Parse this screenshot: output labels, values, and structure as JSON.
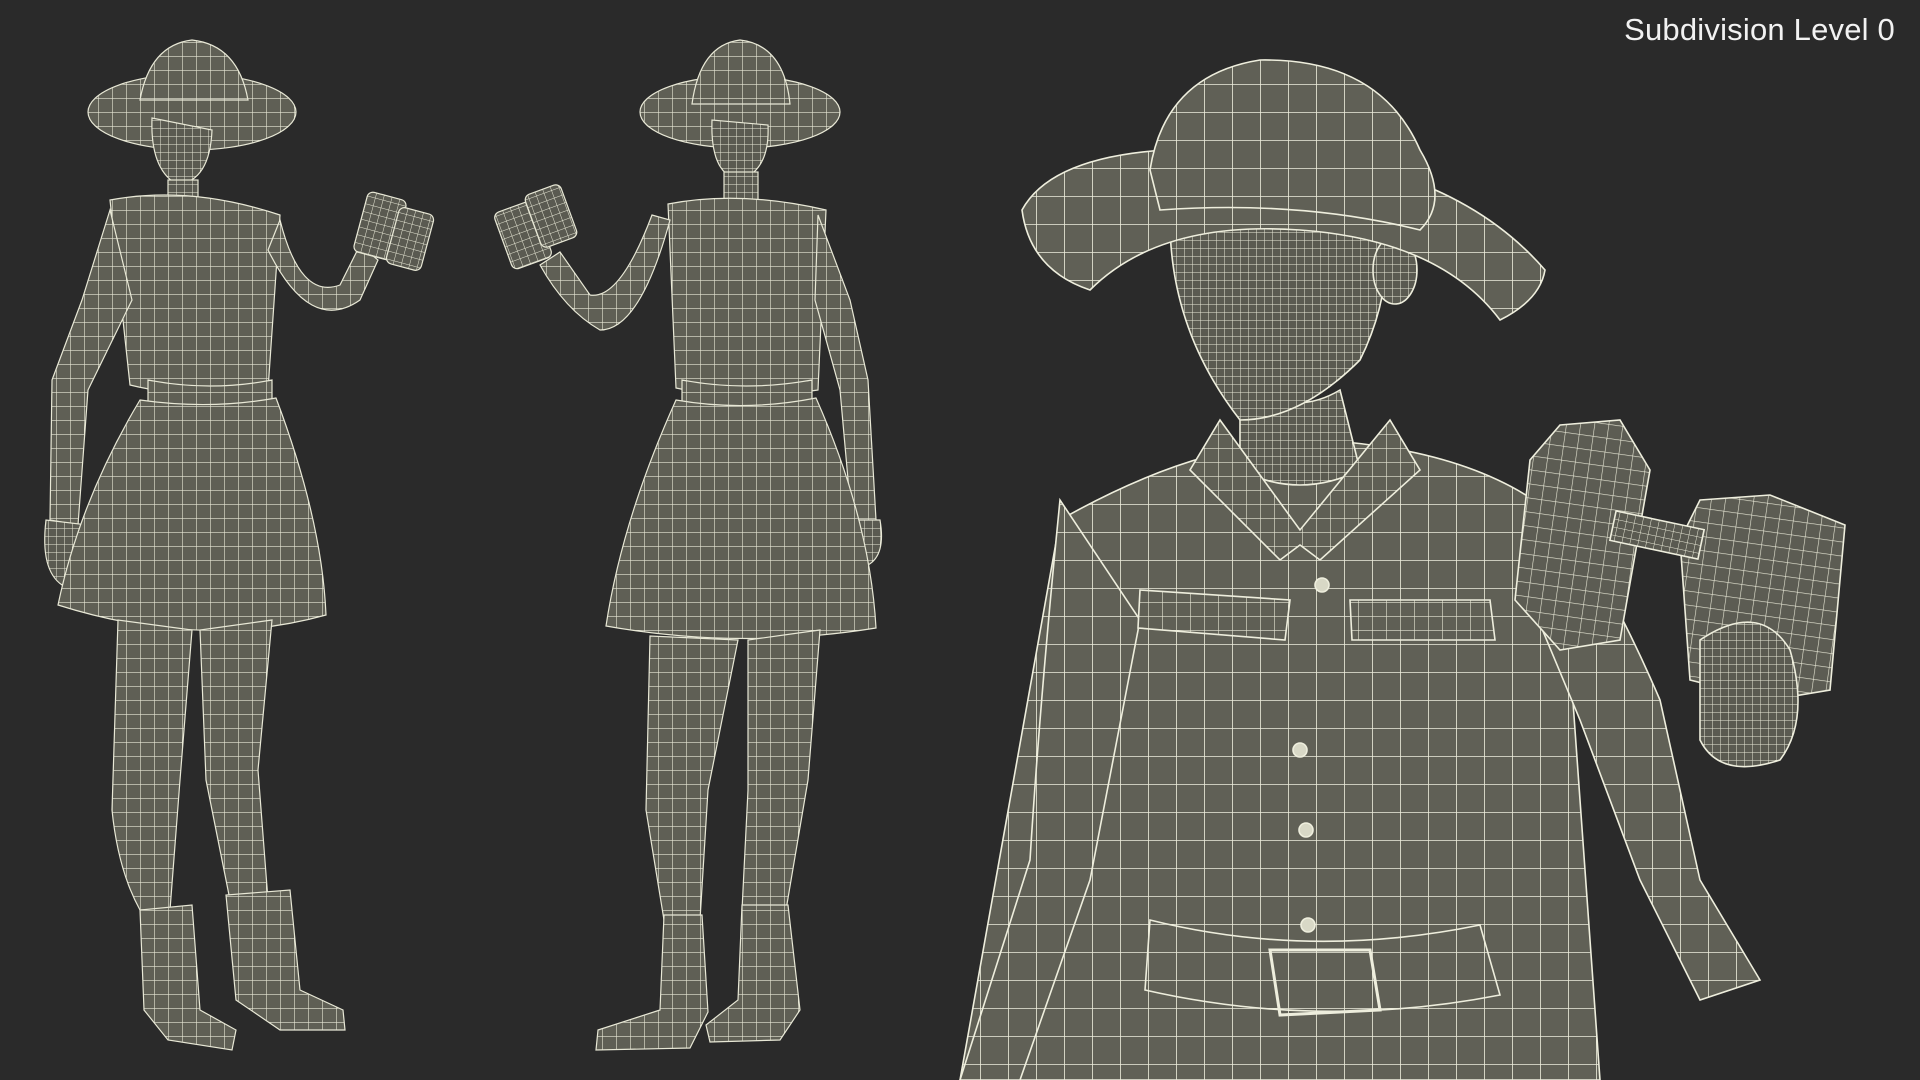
{
  "caption": "Subdivision Level 0",
  "colors": {
    "background": "#2a2a2a",
    "mesh_fill": "#5f5f55",
    "mesh_fill_dark": "#4d4d45",
    "wire": "#eeeedd",
    "caption_text": "#f2f2f2"
  },
  "figures": [
    {
      "view": "front-three-quarter full body"
    },
    {
      "view": "back three-quarter full body"
    },
    {
      "view": "close-up upper body with binoculars"
    }
  ]
}
